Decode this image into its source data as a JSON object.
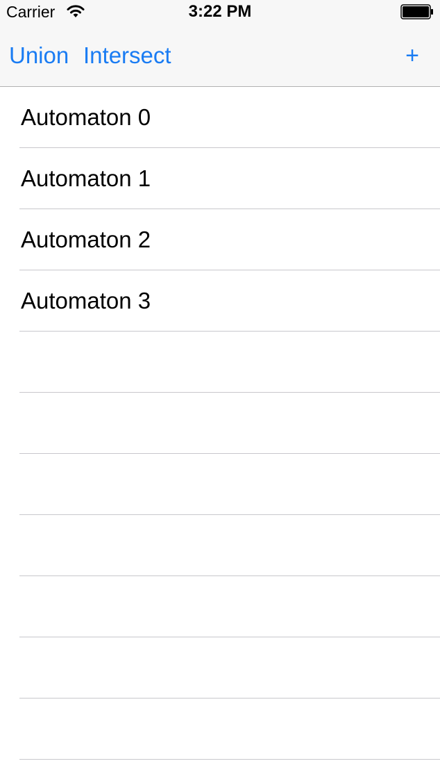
{
  "status_bar": {
    "carrier": "Carrier",
    "time": "3:22 PM",
    "wifi_icon": "wifi-icon",
    "battery_icon": "battery-icon"
  },
  "nav_bar": {
    "union_label": "Union",
    "intersect_label": "Intersect",
    "add_label": "+",
    "accent_color": "#1a7cf3"
  },
  "table": {
    "rows": [
      {
        "label": "Automaton 0"
      },
      {
        "label": "Automaton 1"
      },
      {
        "label": "Automaton 2"
      },
      {
        "label": "Automaton 3"
      },
      {
        "label": ""
      },
      {
        "label": ""
      },
      {
        "label": ""
      },
      {
        "label": ""
      },
      {
        "label": ""
      },
      {
        "label": ""
      },
      {
        "label": ""
      },
      {
        "label": ""
      }
    ]
  }
}
